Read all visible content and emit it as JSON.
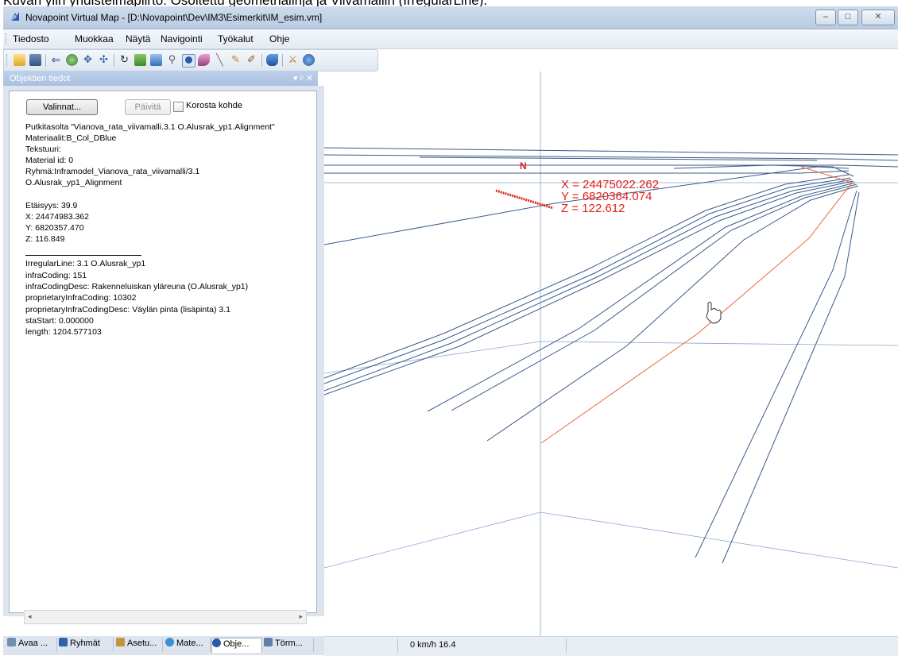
{
  "caption": "Kuvan ylin yhdistelmäpiirto: Osoitettu geometrialinja ja Viivamallin (IrregularLine).",
  "window": {
    "title": "Novapoint Virtual Map - [D:\\Novapoint\\Dev\\IM3\\Esimerkit\\IM_esim.vm]",
    "controls": {
      "minimize": "–",
      "maximize": "□",
      "close": "✕"
    }
  },
  "menu": [
    "Tiedosto",
    "Muokkaa",
    "Näytä",
    "Navigointi",
    "Työkalut",
    "Ohje"
  ],
  "toolbar": {
    "icons": [
      "open-folder-icon",
      "map-icon",
      "back-arrow-icon",
      "globe-icon",
      "move-icon",
      "pan-icon",
      "rotate-icon",
      "fly-icon",
      "layer-icon",
      "zoom-icon",
      "object-info-icon",
      "paint-icon",
      "line-icon",
      "pen-icon",
      "brush-icon",
      "pointer-icon",
      "measure-icon",
      "help-icon"
    ]
  },
  "panel": {
    "title": "Objektien tiedot",
    "controls": "▾ ᵖ ✕",
    "valinnat_label": "Valinnat...",
    "paivita_label": "Päivitä",
    "korosta_label": "Korosta kohde",
    "info_lines": [
      "Putkitasolta \"Vianova_rata_viivamalli.3.1 O.Alusrak_yp1.Alignment\"",
      "Materiaalit:B_Col_DBlue",
      "Tekstuuri:",
      "Material id: 0",
      "Ryhmä:Inframodel_Vianova_rata_viivamalli/3.1",
      "O.Alusrak_yp1_Alignment",
      "",
      "Etäisyys:    39.9",
      "X: 24474983.362",
      "Y: 6820357.470",
      "Z: 116.849"
    ],
    "irregular_lines": [
      "IrregularLine: 3.1 O.Alusrak_yp1",
      " infraCoding: 151",
      " infraCodingDesc: Rakenneluiskan yläreuna (O.Alusrak_yp1)",
      " proprietaryInfraCoding: 10302",
      " proprietaryInfraCodingDesc: Väylän pinta (lisäpinta) 3.1",
      " staStart: 0.000000",
      " length: 1204.577103"
    ]
  },
  "tabs": [
    "Avaa ...",
    "Ryhmät",
    "Asetu...",
    "Mate...",
    "Obje...",
    "Törm..."
  ],
  "status": {
    "speed": "0 km/h  16.4"
  },
  "viewport": {
    "north": "N",
    "coords": [
      "X = 24475022.262",
      "Y = 6820364.074",
      "Z = 122.612"
    ],
    "colors": {
      "line": "#3b5a8a",
      "highlight": "#f0643a",
      "axis": "#8aa7cf",
      "marker": "#e2221d"
    }
  }
}
